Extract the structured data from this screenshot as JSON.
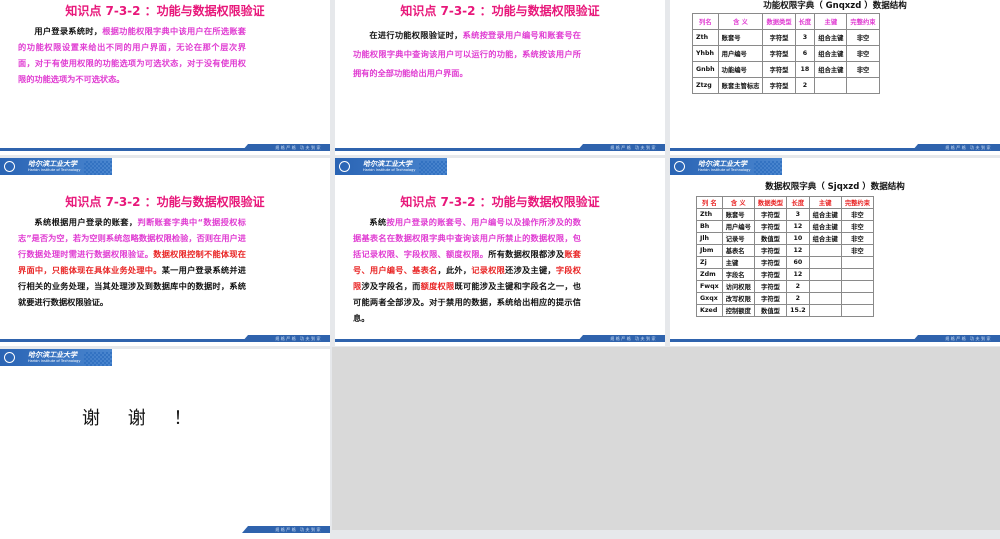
{
  "logo": {
    "cn": "哈尔滨工业大学",
    "en": "Harbin Institute of Technology"
  },
  "footer_motto": "规格严格 功夫到家",
  "slide_title": "知识点 7-3-2 ：功能与数据权限验证",
  "slide1": {
    "seg": [
      "用户登录系统时，",
      "根据功能权限字典中该用户在所选账套的功能权限设置来给出不同的用户界面，无论在那个层次界面，对于有使用权限的功能选项为可选状态，对于没有使用权限的功能选项为不可选状态。"
    ]
  },
  "slide2": {
    "seg": [
      "在进行功能权限验证时，",
      "系统按登录用户编号和账套号在功能权限字典中查询该用户可以运行的功能，系统按该用户所拥有的全部功能给出用户界面。"
    ]
  },
  "slide3": {
    "title": "功能权限字典（ Gnqxzd ）数据结构",
    "headers": [
      "列名",
      "含 义",
      "数据类型",
      "长度",
      "主键",
      "完整约束"
    ],
    "rows": [
      [
        "Zth",
        "账套号",
        "字符型",
        "3",
        "组合主键",
        "非空"
      ],
      [
        "Yhbh",
        "用户编号",
        "字符型",
        "6",
        "组合主键",
        "非空"
      ],
      [
        "Gnbh",
        "功能编号",
        "字符型",
        "18",
        "组合主键",
        "非空"
      ],
      [
        "Ztzg",
        "账套主管标志",
        "字符型",
        "2",
        "",
        ""
      ]
    ]
  },
  "slide4": {
    "seg": [
      "系统根据用户登录的账套，",
      "判断账套字典中“数据授权标志”是否为空，若为空则系统忽略数据权限检验，否则在用户进行数据处理时需进行数据权限验证。",
      "数据权限控制不能体现在界面中，只能体现在具体业务处理中。",
      "某一用户登录系统并进行相关的业务处理，当其处理涉及到数据库中的数据时，系统就要进行数据权限验证。"
    ]
  },
  "slide5": {
    "seg": [
      "系统",
      "按用户登录的账套号、用户编号以及操作所涉及的数据基表名在数据权限字典中查询该用户所禁止的数据权限，包括记录权限、字段权限、额度权限。",
      "所有数据权限都涉及",
      "账套号、用户编号、基表名",
      "，此外，",
      "记录权限",
      "还涉及主键，",
      "字段权限",
      "涉及字段名，而",
      "额度权限",
      "既可能涉及主键和字段名之一，也可能两者全部涉及。对于禁用的数据，系统给出相应的提示信息。"
    ]
  },
  "slide6": {
    "title": "数据权限字典（ Sjqxzd ）数据结构",
    "headers": [
      "列 名",
      "含 义",
      "数据类型",
      "长度",
      "主键",
      "完整约束"
    ],
    "rows": [
      [
        "Zth",
        "账套号",
        "字符型",
        "3",
        "组合主键",
        "非空"
      ],
      [
        "Bh",
        "用户编号",
        "字符型",
        "12",
        "组合主键",
        "非空"
      ],
      [
        "Jlh",
        "记录号",
        "数值型",
        "10",
        "组合主键",
        "非空"
      ],
      [
        "Jbm",
        "基表名",
        "字符型",
        "12",
        "",
        "非空"
      ],
      [
        "Zj",
        "主键",
        "字符型",
        "60",
        "",
        ""
      ],
      [
        "Zdm",
        "字段名",
        "字符型",
        "12",
        "",
        ""
      ],
      [
        "Fwqx",
        "访问权限",
        "字符型",
        "2",
        "",
        ""
      ],
      [
        "Gxqx",
        "改写权限",
        "字符型",
        "2",
        "",
        ""
      ],
      [
        "Kzed",
        "控制额度",
        "数值型",
        "15.2",
        "",
        ""
      ]
    ]
  },
  "slide7": {
    "text": "谢 谢 ！"
  }
}
